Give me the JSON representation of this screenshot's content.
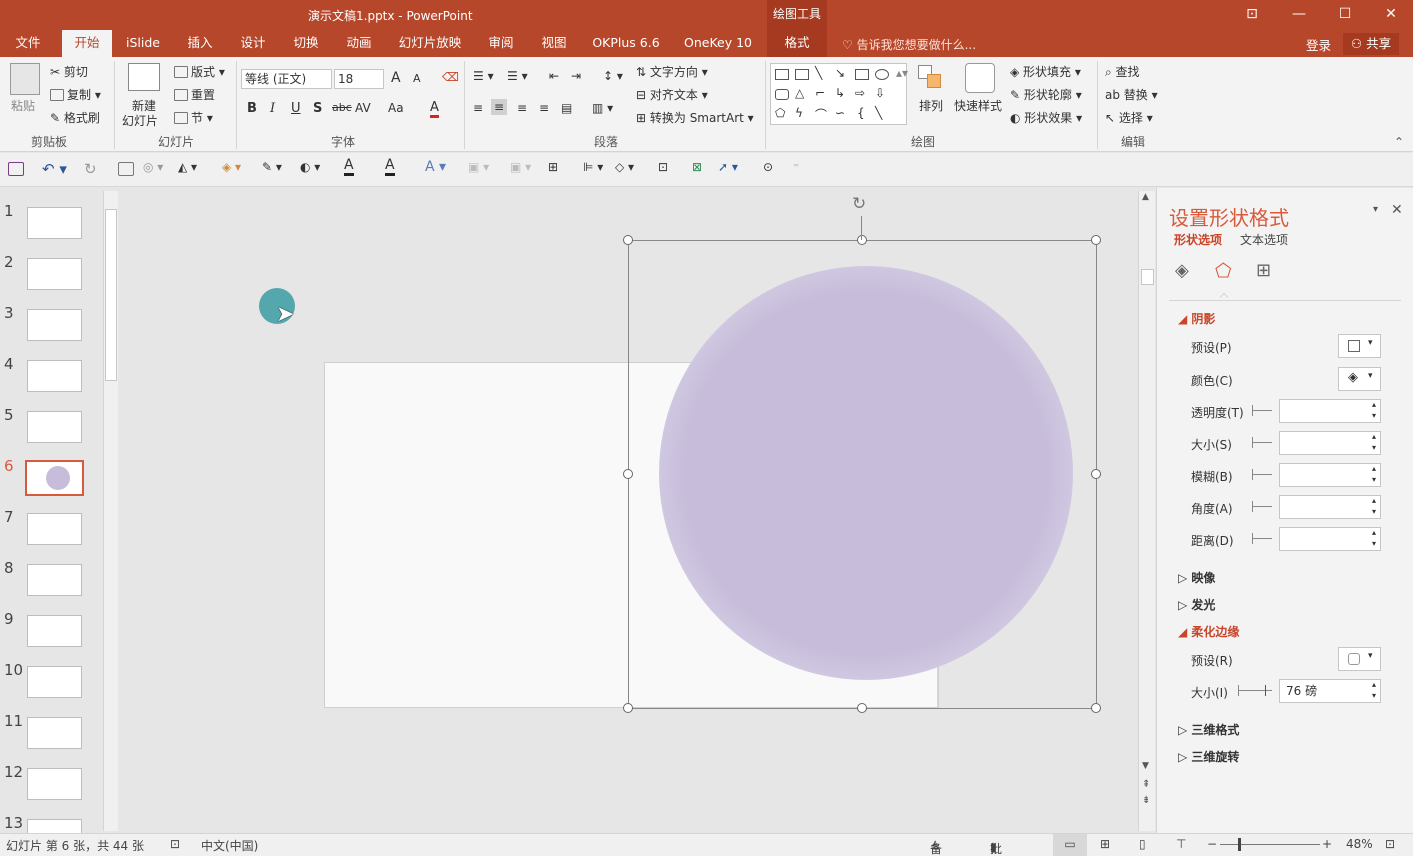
{
  "titlebar": {
    "title": "演示文稿1.pptx - PowerPoint",
    "context_group": "绘图工具"
  },
  "tabs": [
    "文件",
    "开始",
    "iSlide",
    "插入",
    "设计",
    "切换",
    "动画",
    "幻灯片放映",
    "审阅",
    "视图",
    "OKPlus 6.6",
    "OneKey 10",
    "格式"
  ],
  "tell_me": "告诉我您想要做什么...",
  "login": "登录",
  "share": "共享",
  "ribbon": {
    "clipboard": {
      "paste": "粘贴",
      "cut": "剪切",
      "copy": "复制",
      "format_painter": "格式刷",
      "label": "剪贴板"
    },
    "slides": {
      "new_slide_1": "新建",
      "new_slide_2": "幻灯片",
      "layout": "版式",
      "reset": "重置",
      "section": "节",
      "label": "幻灯片"
    },
    "font": {
      "font_name": "等线 (正文)",
      "font_size": "18",
      "label": "字体",
      "bold": "B",
      "italic": "I",
      "underline": "U",
      "shadow": "S",
      "strike": "abc",
      "spacing": "AV",
      "case": "Aa",
      "grow": "A",
      "shrink": "A"
    },
    "paragraph": {
      "text_direction": "文字方向",
      "align_text": "对齐文本",
      "smartart": "转换为 SmartArt",
      "label": "段落"
    },
    "drawing": {
      "arrange": "排列",
      "quick_styles": "快速样式",
      "shape_fill": "形状填充",
      "shape_outline": "形状轮廓",
      "shape_effects": "形状效果",
      "label": "绘图"
    },
    "editing": {
      "find": "查找",
      "replace": "替换",
      "select": "选择",
      "label": "编辑"
    }
  },
  "slides": {
    "numbers": [
      "1",
      "2",
      "3",
      "4",
      "5",
      "6",
      "7",
      "8",
      "9",
      "10",
      "11",
      "12",
      "13"
    ],
    "selected": "6"
  },
  "pane": {
    "title": "设置形状格式",
    "tab_shape": "形状选项",
    "tab_text": "文本选项",
    "shadow": {
      "header": "阴影",
      "preset": "预设(P)",
      "color": "颜色(C)",
      "transparency": "透明度(T)",
      "size": "大小(S)",
      "blur": "模糊(B)",
      "angle": "角度(A)",
      "distance": "距离(D)"
    },
    "reflection": "映像",
    "glow": "发光",
    "soft_edges": {
      "header": "柔化边缘",
      "preset": "预设(R)",
      "size": "大小(I)",
      "size_value": "76 磅"
    },
    "format_3d": "三维格式",
    "rotation_3d": "三维旋转"
  },
  "status": {
    "slide_info": "幻灯片 第 6 张，共 44 张",
    "language": "中文(中国)",
    "notes": "备注",
    "comments": "批注",
    "zoom": "48%"
  },
  "colors": {
    "accent": "#b7472a",
    "pane_title": "#d75b3b",
    "blob": "#c7bddb",
    "cursor_dot": "#3a9ba1"
  }
}
